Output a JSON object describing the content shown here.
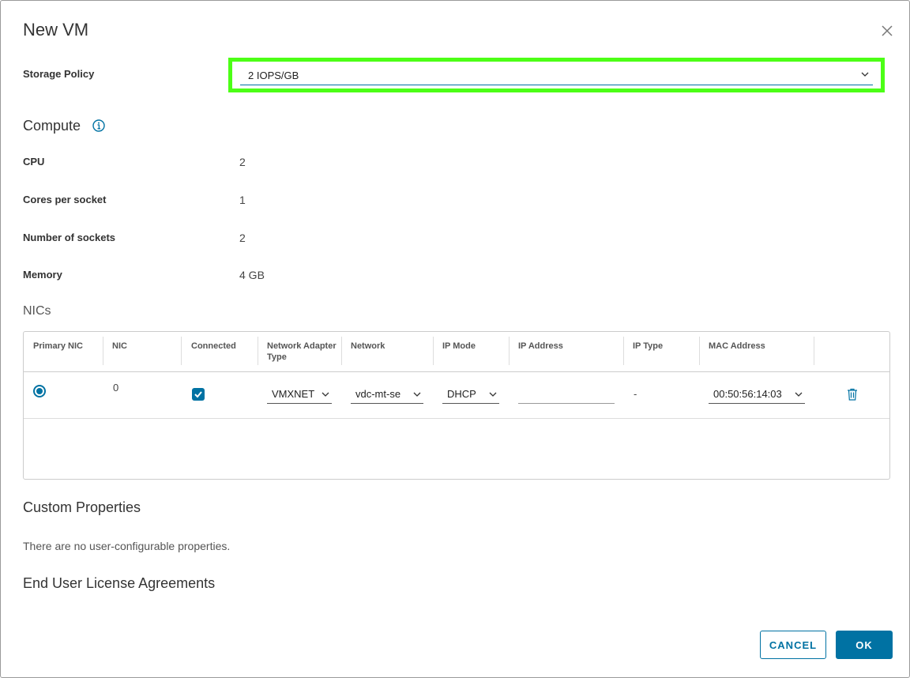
{
  "dialog": {
    "title": "New VM"
  },
  "storage_policy": {
    "label": "Storage Policy",
    "value": "2 IOPS/GB"
  },
  "compute": {
    "title": "Compute",
    "fields": [
      {
        "label": "CPU",
        "value": "2"
      },
      {
        "label": "Cores per socket",
        "value": "1"
      },
      {
        "label": "Number of sockets",
        "value": "2"
      },
      {
        "label": "Memory",
        "value": "4 GB"
      }
    ]
  },
  "nics": {
    "title": "NICs",
    "columns": [
      "Primary NIC",
      "NIC",
      "Connected",
      "Network Adapter Type",
      "Network",
      "IP Mode",
      "IP Address",
      "IP Type",
      "MAC Address"
    ],
    "rows": [
      {
        "primary": true,
        "nic": "0",
        "connected": true,
        "adapter_type": "VMXNET",
        "network": "vdc-mt-se",
        "ip_mode": "DHCP",
        "ip_address": "",
        "ip_type": "-",
        "mac_address": "00:50:56:14:03"
      }
    ]
  },
  "custom_properties": {
    "title": "Custom Properties",
    "empty_text": "There are no user-configurable properties."
  },
  "eula": {
    "title": "End User License Agreements"
  },
  "footer": {
    "cancel_label": "CANCEL",
    "ok_label": "OK"
  },
  "colors": {
    "accent": "#0072a3",
    "highlight": "#4cff16"
  }
}
